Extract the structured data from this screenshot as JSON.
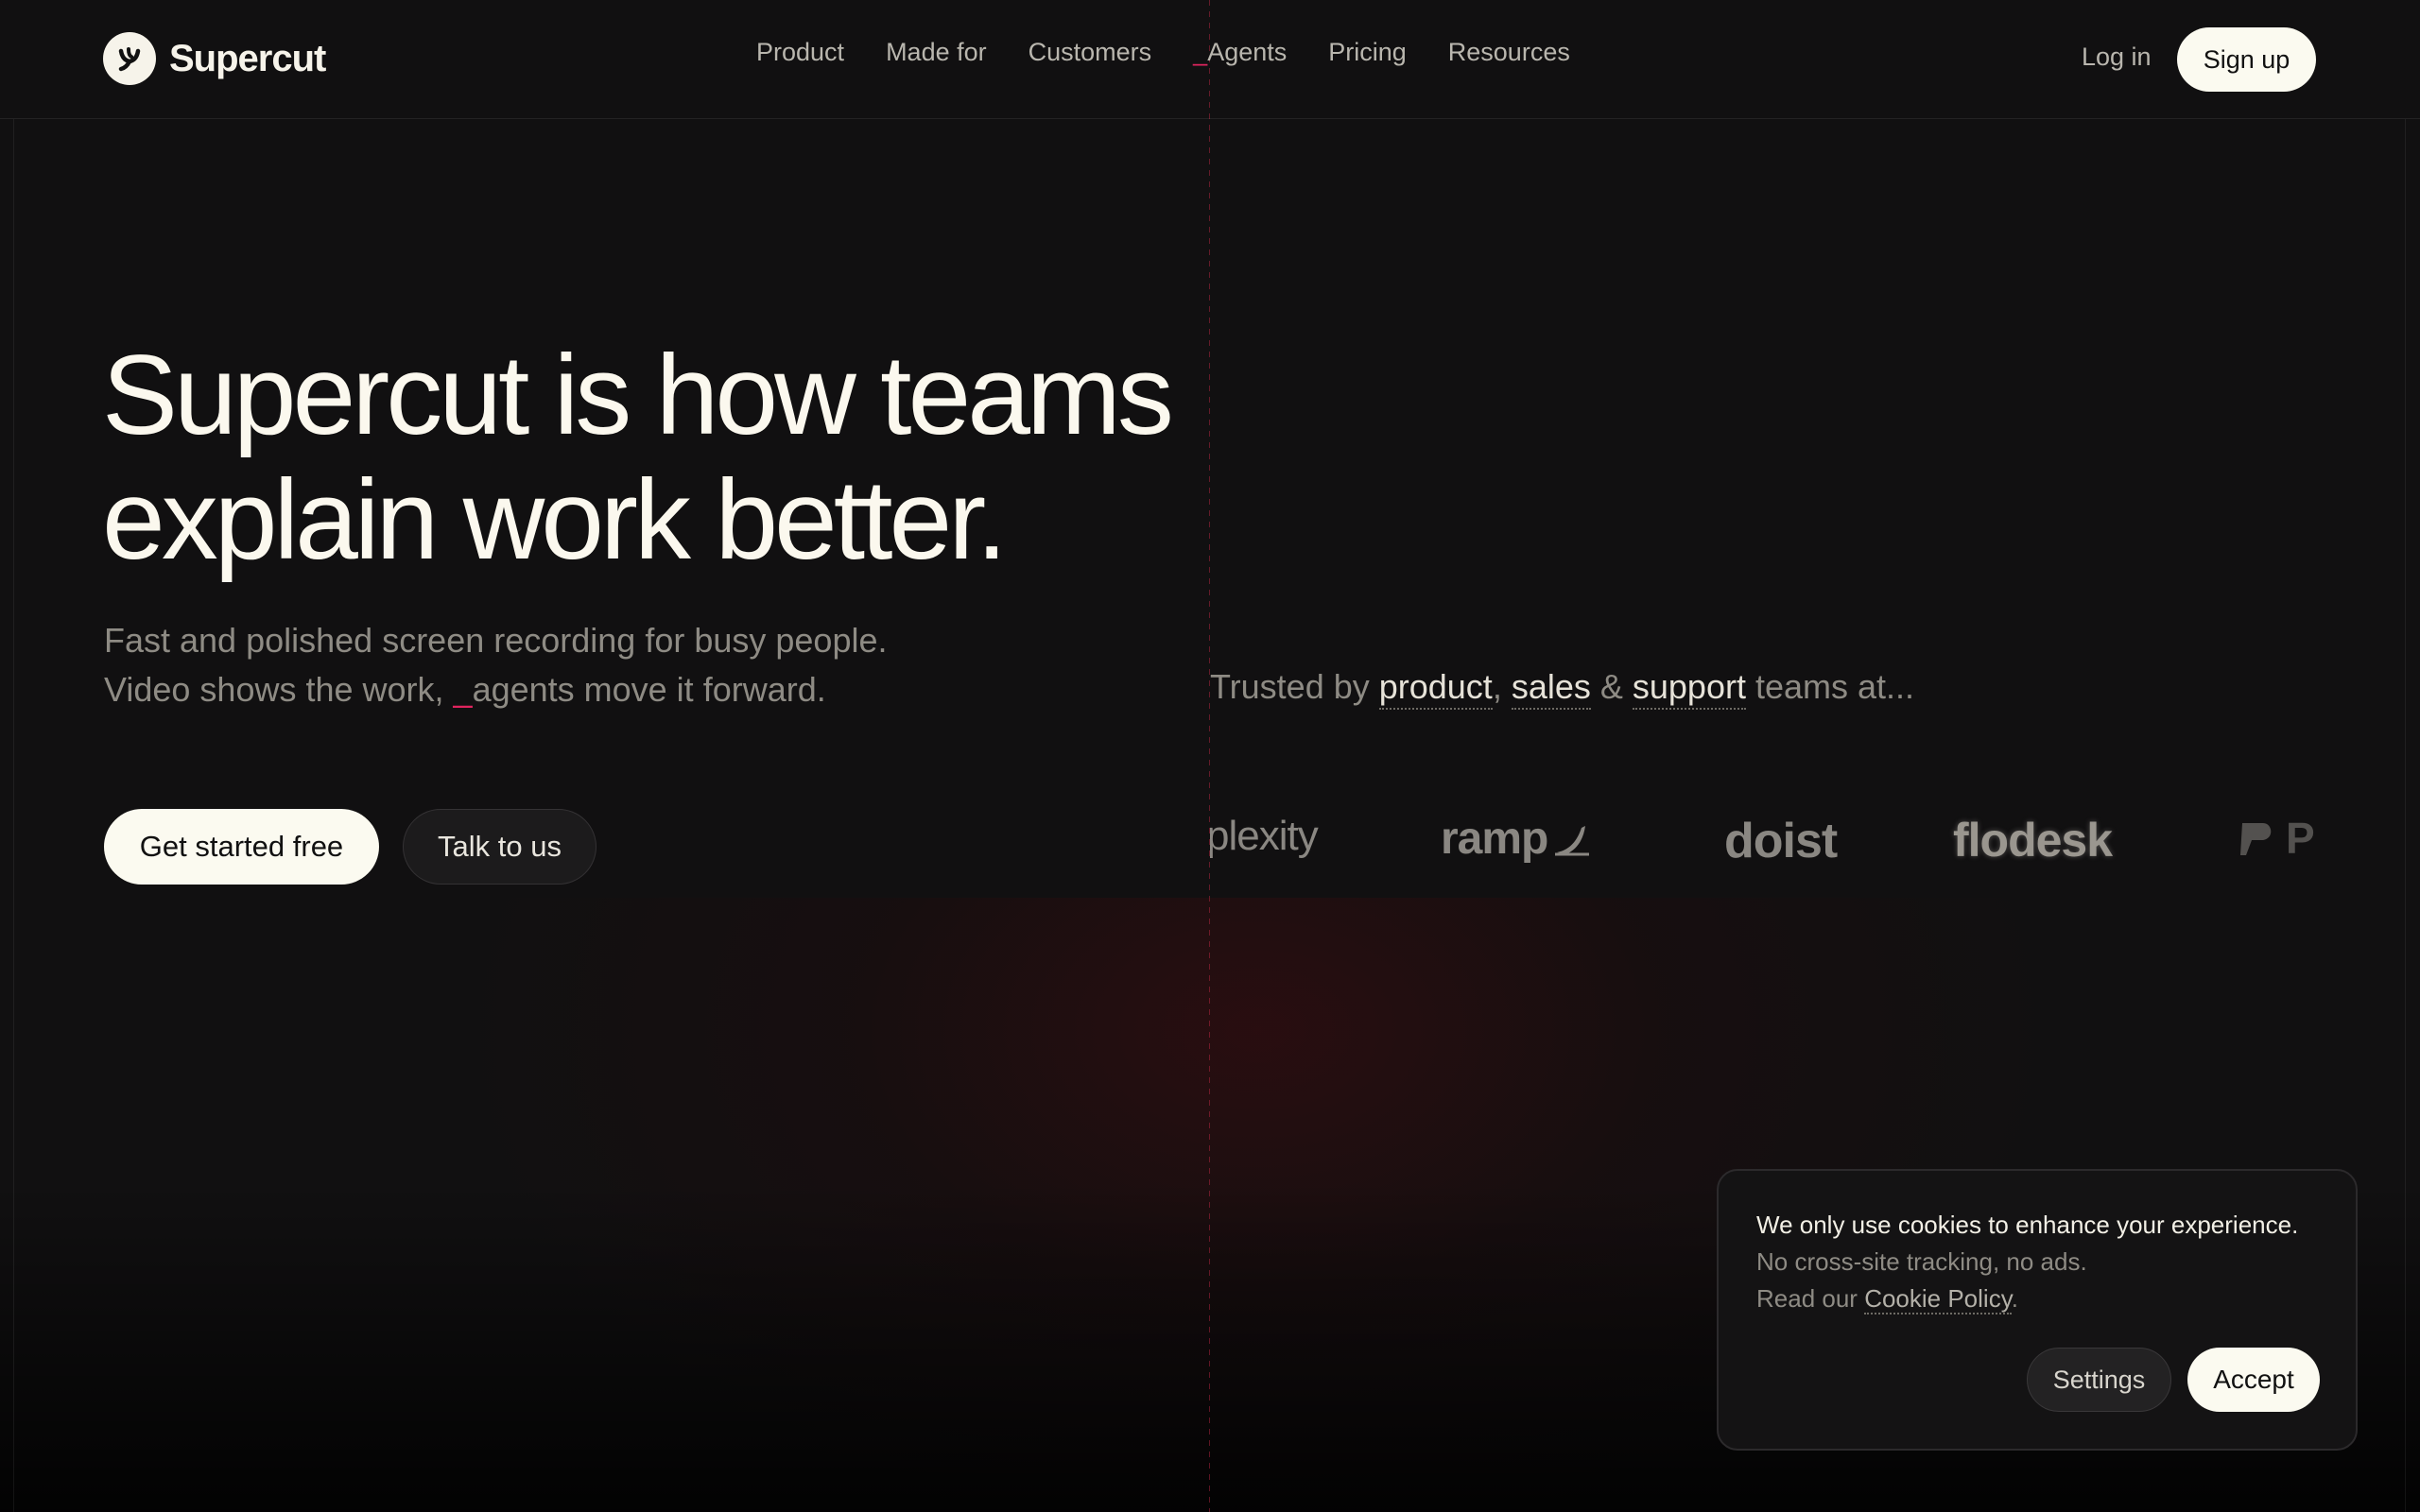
{
  "brand": {
    "name": "Supercut",
    "logo_icon": "supercut-logo-icon"
  },
  "nav": {
    "items": [
      {
        "label": "Product"
      },
      {
        "label": "Made for"
      },
      {
        "label": "Customers"
      },
      {
        "label": "Agents",
        "prefix": "_"
      },
      {
        "label": "Pricing"
      },
      {
        "label": "Resources"
      }
    ],
    "login_label": "Log in",
    "signup_label": "Sign up"
  },
  "hero": {
    "title_line1": "Supercut is how teams",
    "title_line2": "explain work better.",
    "subtitle_line1": "Fast and polished screen recording for busy people.",
    "subtitle_line2_before": "Video shows the work, ",
    "subtitle_line2_accent": "_",
    "subtitle_line2_after": "agents move it forward.",
    "cta_primary": "Get started free",
    "cta_secondary": "Talk to us"
  },
  "trusted": {
    "prefix": "Trusted by ",
    "team1": "product",
    "sep1": ", ",
    "team2": "sales",
    "sep2": " & ",
    "team3": "support",
    "suffix": " teams at..."
  },
  "customer_logos": [
    {
      "name": "plexity",
      "icon": ""
    },
    {
      "name": "ramp",
      "icon": "ramp-swoosh-icon"
    },
    {
      "name": "doist",
      "icon": ""
    },
    {
      "name": "flodesk",
      "icon": ""
    },
    {
      "name": "P",
      "icon": "partial-brand-icon"
    }
  ],
  "cookie_banner": {
    "text_strong": "We only use cookies to enhance your experience.",
    "text_rest": " No cross-site tracking, no ads.",
    "read_prefix": "Read our ",
    "link_label": "Cookie Policy",
    "read_suffix": ".",
    "settings_label": "Settings",
    "accept_label": "Accept"
  },
  "colors": {
    "background": "#111011",
    "accent": "#e0245e",
    "button_light": "#fbfaf0",
    "text_muted": "#8e8b84"
  }
}
